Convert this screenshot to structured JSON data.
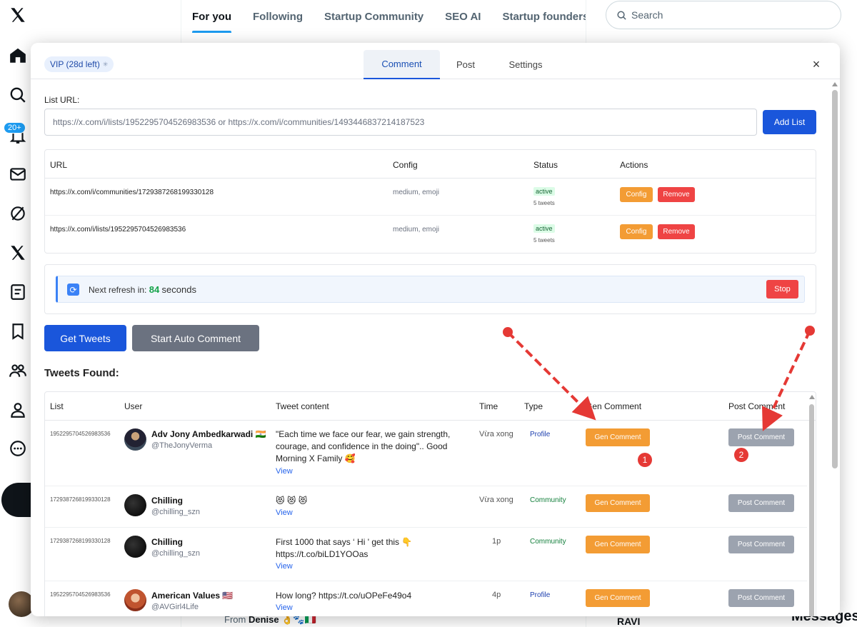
{
  "x_page": {
    "notif_badge": "20+",
    "tabs": [
      "For you",
      "Following",
      "Startup Community",
      "SEO AI",
      "Startup founders & fr"
    ],
    "search_placeholder": "Search",
    "from_prefix": "From",
    "from_name": "Denise",
    "from_emoji": "👌🐾🇮🇹",
    "ravi": "RAVI",
    "messages": "Messages",
    "accent_color": "#1d9bf0"
  },
  "modal": {
    "vip_label": "VIP (28d left)",
    "tabs": [
      "Comment",
      "Post",
      "Settings"
    ],
    "active_tab": "Comment",
    "close": "×",
    "list_url_label": "List URL:",
    "list_url_placeholder": "https://x.com/i/lists/1952295704526983536 or https://x.com/i/communities/1493446837214187523",
    "add_list_label": "Add List",
    "lists_table": {
      "headers": [
        "URL",
        "Config",
        "Status",
        "Actions"
      ],
      "rows": [
        {
          "url": "https://x.com/i/communities/1729387268199330128",
          "config": "medium, emoji",
          "status": "active",
          "status_sub": "5 tweets",
          "config_btn": "Config",
          "remove_btn": "Remove"
        },
        {
          "url": "https://x.com/i/lists/1952295704526983536",
          "config": "medium, emoji",
          "status": "active",
          "status_sub": "5 tweets",
          "config_btn": "Config",
          "remove_btn": "Remove"
        }
      ]
    },
    "refresh": {
      "icon": "refresh-icon",
      "label": "Next refresh in:",
      "seconds": "84",
      "unit": "seconds",
      "stop_label": "Stop"
    },
    "get_tweets_label": "Get Tweets",
    "auto_comment_label": "Start Auto Comment",
    "tweets_found_title": "Tweets Found:",
    "tweets_table": {
      "headers": [
        "List",
        "User",
        "Tweet content",
        "Time",
        "Type",
        "Gen Comment",
        "Post Comment"
      ],
      "rows": [
        {
          "list": "1952295704526983536",
          "name": "Adv Jony Ambedkarwadi 🇮🇳",
          "handle": "@TheJonyVerma",
          "content": "\"Each time we face our fear, we gain strength, courage, and confidence in the doing\".. Good Morning X Family 🥰",
          "view": "View",
          "time": "Vừa xong",
          "type": "Profile",
          "gen": "Gen Comment",
          "post": "Post Comment"
        },
        {
          "list": "1729387268199330128",
          "name": "Chilling",
          "handle": "@chilling_szn",
          "content": "😻 😻 😻",
          "view": "View",
          "time": "Vừa xong",
          "type": "Community",
          "gen": "Gen Comment",
          "post": "Post Comment"
        },
        {
          "list": "1729387268199330128",
          "name": "Chilling",
          "handle": "@chilling_szn",
          "content": "First 1000 that says ‘ Hi ' get this 👇 https://t.co/biLD1YOOas",
          "view": "View",
          "time": "1p",
          "type": "Community",
          "gen": "Gen Comment",
          "post": "Post Comment"
        },
        {
          "list": "1952295704526983536",
          "name": "American Values 🇺🇸",
          "handle": "@AVGirl4Life",
          "content": "How long? https://t.co/uOPeFe49o4",
          "view": "View",
          "time": "4p",
          "type": "Profile",
          "gen": "Gen Comment",
          "post": "Post Comment"
        }
      ]
    },
    "annotations": [
      "1",
      "2"
    ],
    "colors": {
      "primary": "#1a56db",
      "orange": "#f39c34",
      "red": "#ef4444",
      "gray": "#6b7280",
      "annotation": "#e53935"
    }
  }
}
